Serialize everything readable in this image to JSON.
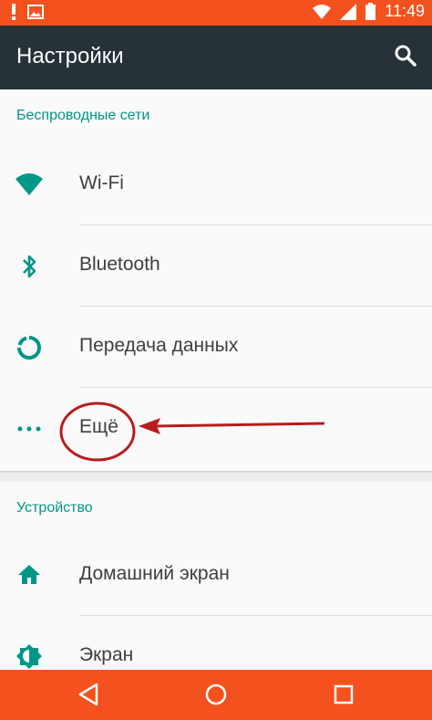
{
  "status_bar": {
    "time": "11:49",
    "icons": [
      "warning-icon",
      "image-icon",
      "wifi-icon",
      "signal-icon",
      "battery-icon"
    ]
  },
  "toolbar": {
    "title": "Настройки",
    "search_icon": "search-icon"
  },
  "sections": [
    {
      "title": "Беспроводные сети",
      "items": [
        {
          "label": "Wi-Fi",
          "icon": "wifi-icon"
        },
        {
          "label": "Bluetooth",
          "icon": "bluetooth-icon"
        },
        {
          "label": "Передача данных",
          "icon": "data-usage-icon"
        },
        {
          "label": "Ещё",
          "icon": "more-dots-icon"
        }
      ]
    },
    {
      "title": "Устройство",
      "items": [
        {
          "label": "Домашний экран",
          "icon": "home-icon"
        },
        {
          "label": "Экран",
          "icon": "brightness-icon"
        }
      ]
    }
  ],
  "nav_bar": {
    "buttons": [
      "back-icon",
      "home-circle-icon",
      "recents-icon"
    ]
  },
  "colors": {
    "status_bar": "#f4511e",
    "toolbar": "#263238",
    "accent": "#009688",
    "annotation": "#b71c1c"
  }
}
